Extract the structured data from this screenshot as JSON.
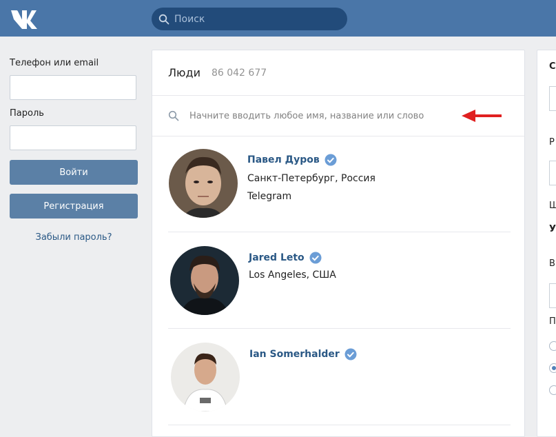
{
  "header": {
    "logo": "vk-logo",
    "search_placeholder": "Поиск"
  },
  "login": {
    "phone_label": "Телефон или email",
    "password_label": "Пароль",
    "login_button": "Войти",
    "register_button": "Регистрация",
    "forgot_link": "Забыли пароль?"
  },
  "people": {
    "title": "Люди",
    "count": "86 042 677",
    "search_placeholder": "Начните вводить любое имя, название или слово",
    "results": [
      {
        "name": "Павел Дуров",
        "verified": true,
        "lines": [
          "Санкт-Петербург, Россия",
          "Telegram"
        ]
      },
      {
        "name": "Jared Leto",
        "verified": true,
        "lines": [
          "Los Angeles, США"
        ]
      },
      {
        "name": "Ian Somerhalder",
        "verified": true,
        "lines": []
      }
    ]
  },
  "right_panel": {
    "letters": [
      "С",
      "Р",
      "Ш",
      "У",
      "В",
      "П"
    ]
  },
  "colors": {
    "header": "#4a76a8",
    "link": "#2a5885",
    "button": "#5b80a6",
    "annotation_arrow": "#e02020"
  }
}
